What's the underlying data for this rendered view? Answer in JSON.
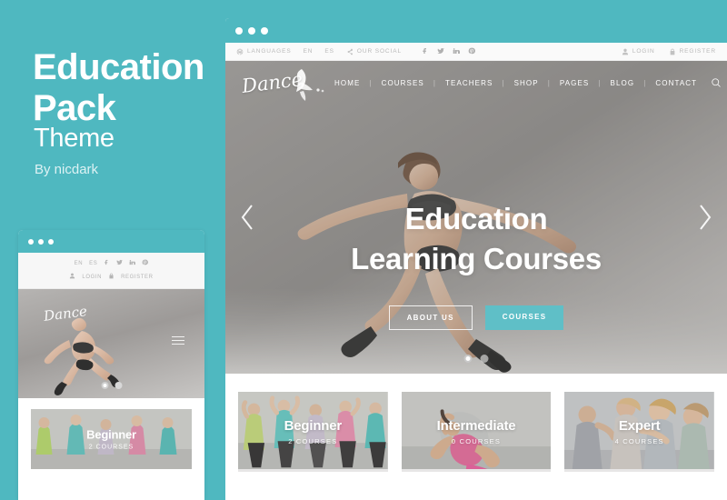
{
  "promo": {
    "title_line1": "Education",
    "title_line2": "Pack",
    "subtitle": "Theme",
    "author": "By nicdark",
    "accent_color": "#4FB8C0"
  },
  "browser": {
    "window_dots": 3
  },
  "utility_bar": {
    "languages_label": "LANGUAGES",
    "lang_en": "EN",
    "lang_es": "ES",
    "social_label": "OUR SOCIAL",
    "social_icons": [
      "facebook-icon",
      "twitter-icon",
      "linkedin-icon",
      "pinterest-icon"
    ],
    "login_label": "LOGIN",
    "register_label": "REGISTER"
  },
  "header": {
    "logo_text": "Dance",
    "nav_items": [
      "HOME",
      "COURSES",
      "TEACHERS",
      "SHOP",
      "PAGES",
      "BLOG",
      "CONTACT"
    ],
    "search_icon": "search-icon"
  },
  "hero": {
    "title_line1": "Education",
    "title_line2": "Learning Courses",
    "button_primary": "COURSES",
    "button_secondary": "ABOUT US",
    "prev_arrow": "chevron-left-icon",
    "next_arrow": "chevron-right-icon",
    "slide_count": 2,
    "active_slide": 1
  },
  "cards": [
    {
      "title": "Beginner",
      "count": "2 COURSES"
    },
    {
      "title": "Intermediate",
      "count": "0 COURSES"
    },
    {
      "title": "Expert",
      "count": "4 COURSES"
    }
  ],
  "mini_preview": {
    "lang_en": "EN",
    "lang_es": "ES",
    "login_label": "LOGIN",
    "register_label": "REGISTER",
    "logo_text": "Dance",
    "card_title": "Beginner",
    "card_sub": "2 COURSES"
  }
}
